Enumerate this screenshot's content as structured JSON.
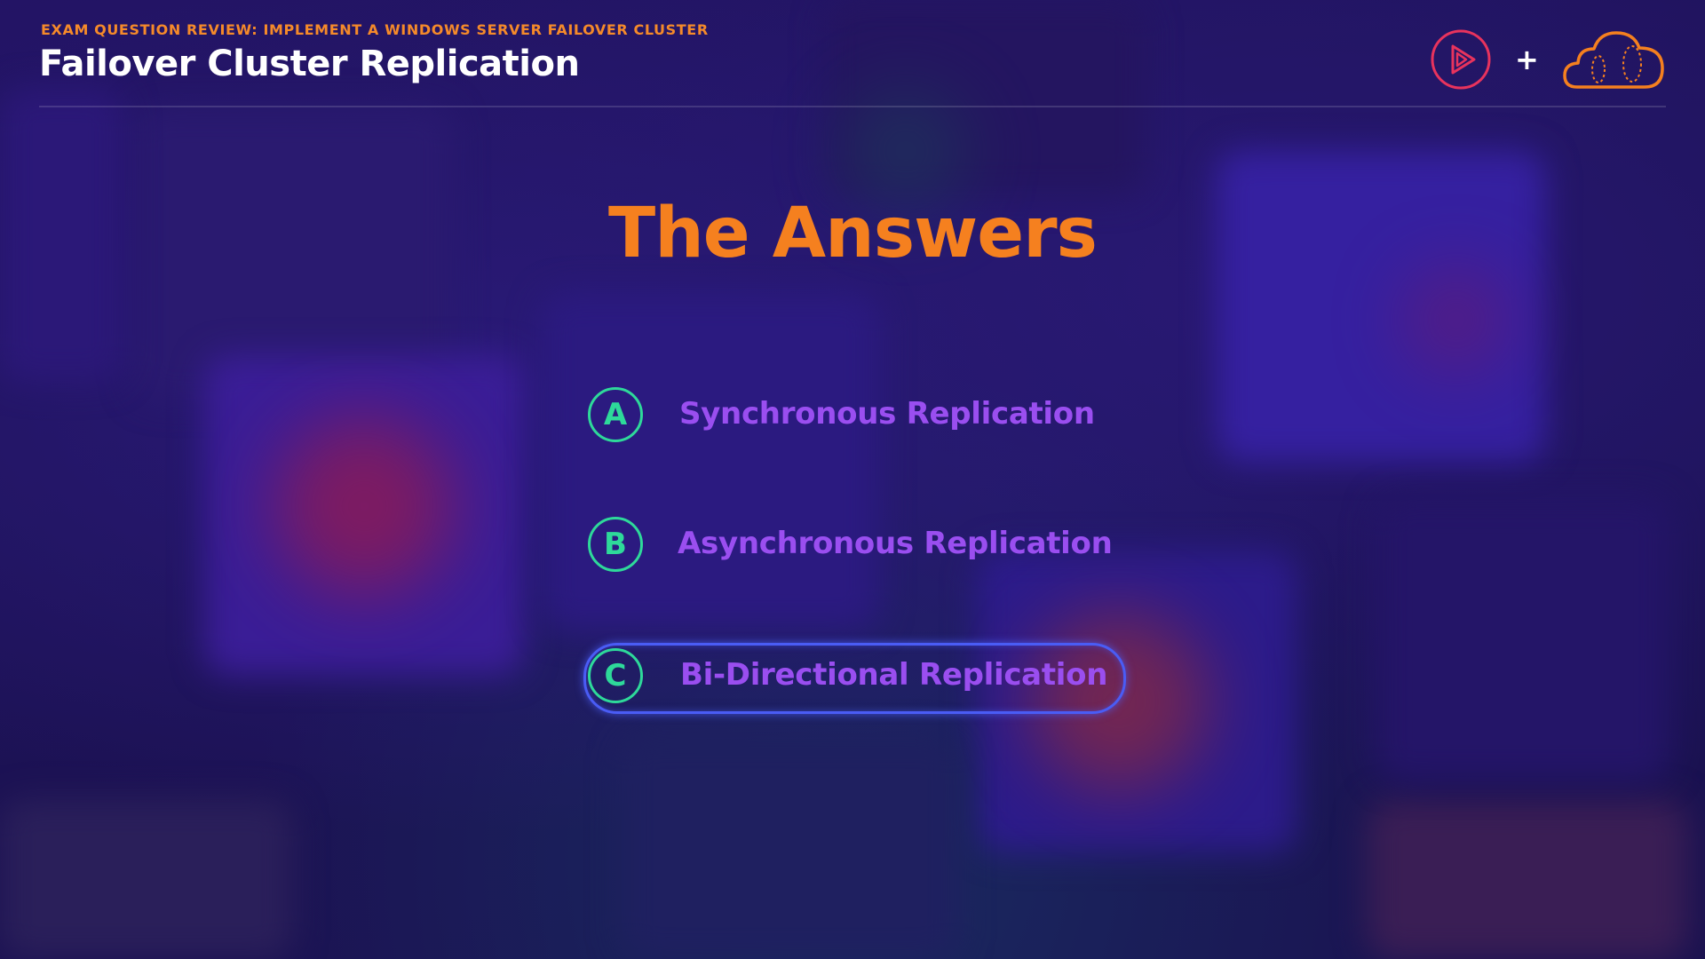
{
  "header": {
    "subtitle": "EXAM QUESTION REVIEW: IMPLEMENT A WINDOWS SERVER FAILOVER CLUSTER",
    "title": "Failover Cluster Replication",
    "logo_left_icon": "pluralsight-play-icon",
    "logo_plus": "+",
    "logo_right_icon": "acloudguru-cloud-icon"
  },
  "slide": {
    "heading": "The Answers",
    "answers": [
      {
        "letter": "A",
        "text": "Synchronous Replication",
        "selected": false
      },
      {
        "letter": "B",
        "text": "Asynchronous Replication",
        "selected": false
      },
      {
        "letter": "C",
        "text": "Bi-Directional Replication",
        "selected": true
      }
    ]
  },
  "colors": {
    "accent_orange": "#f5801f",
    "answer_purple": "#9a4ef0",
    "letter_green": "#2ed99a",
    "highlight_blue": "#4a5cf5",
    "logo_pink": "#e8335d"
  }
}
